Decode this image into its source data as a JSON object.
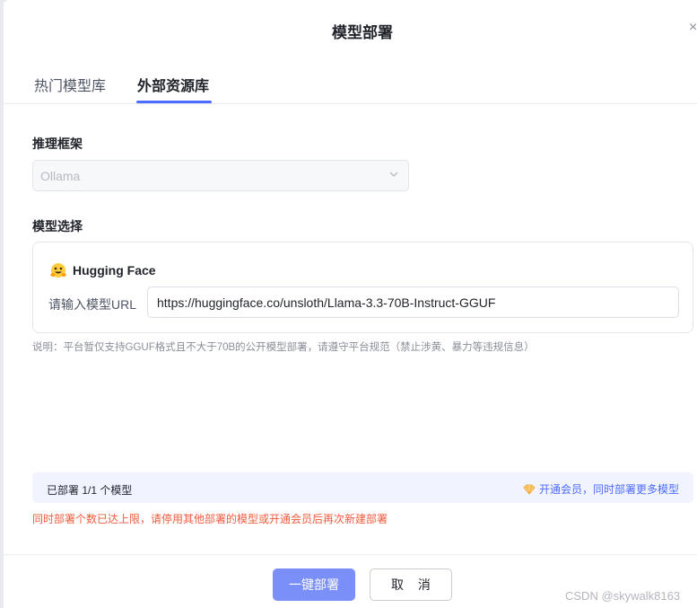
{
  "dialog": {
    "title": "模型部署",
    "close_glyph": "×"
  },
  "tabs": [
    {
      "label": "热门模型库",
      "active": false
    },
    {
      "label": "外部资源库",
      "active": true
    }
  ],
  "framework": {
    "label": "推理框架",
    "selected": "Ollama",
    "disabled": true
  },
  "model_select": {
    "label": "模型选择",
    "source_title": "Hugging Face",
    "source_icon": "hugging-face-emoji-icon",
    "input_label": "请输入模型URL",
    "input_value": "https://huggingface.co/unsloth/Llama-3.3-70B-Instruct-GGUF"
  },
  "note": "说明：平台暂仅支持GGUF格式且不大于70B的公开模型部署，请遵守平台规范（禁止涉黄、暴力等违规信息）",
  "quota": {
    "text": "已部署 1/1 个模型",
    "vip_link": "开通会员，同时部署更多模型",
    "vip_icon": "diamond-icon"
  },
  "warning": "同时部署个数已达上限，请停用其他部署的模型或开通会员后再次新建部署",
  "buttons": {
    "deploy": "一键部署",
    "cancel": "取 消"
  },
  "watermark": "CSDN @skywalk8163",
  "colors": {
    "accent": "#4d6bfe",
    "primary_button": "#7b8ff8",
    "warning": "#f05b3d",
    "quota_bg": "#f1f4fe"
  }
}
